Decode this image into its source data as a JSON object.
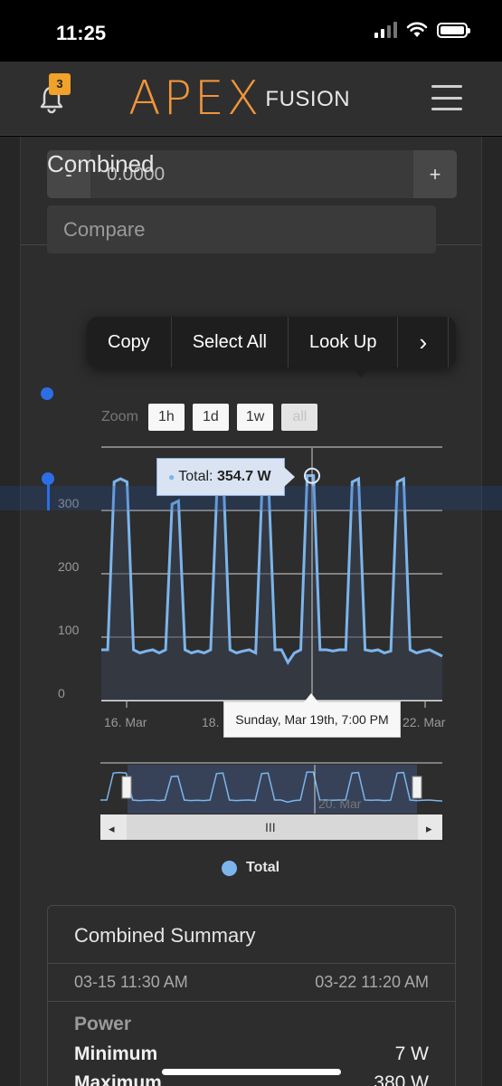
{
  "status_bar": {
    "time": "11:25"
  },
  "nav": {
    "notification_count": "3",
    "logo_main": "APEX",
    "logo_sub": "FUSION"
  },
  "stepper": {
    "minus": "-",
    "value": "0.0000",
    "plus": "+"
  },
  "section": {
    "title": "Combined",
    "compare_placeholder": "Compare"
  },
  "context_menu": {
    "items": [
      "Copy",
      "Select All",
      "Look Up"
    ],
    "more": "›"
  },
  "zoom": {
    "label": "Zoom",
    "buttons": [
      "1h",
      "1d",
      "1w",
      "all"
    ]
  },
  "tooltip": {
    "series": "Total:",
    "value": "354.7 W"
  },
  "x_tooltip": "Sunday, Mar 19th, 7:00 PM",
  "navigator": {
    "label": "20. Mar",
    "grip": "III",
    "left": "◂",
    "right": "▸"
  },
  "legend": {
    "label": "Total",
    "color": "#7cb5ec"
  },
  "chart_data": {
    "type": "area",
    "title": "Combined",
    "xlabel": "",
    "ylabel": "",
    "y_ticks": [
      0,
      100,
      200,
      300
    ],
    "x_ticks": [
      "16. Mar",
      "18.",
      "22. Mar"
    ],
    "ylim": [
      0,
      400
    ],
    "grid": true,
    "legend_position": "bottom",
    "series": [
      {
        "name": "Total",
        "color": "#7cb5ec",
        "values": [
          80,
          80,
          345,
          350,
          345,
          80,
          75,
          78,
          80,
          75,
          80,
          310,
          315,
          80,
          75,
          78,
          75,
          80,
          340,
          345,
          80,
          75,
          78,
          80,
          75,
          340,
          345,
          80,
          80,
          60,
          75,
          80,
          355,
          355,
          80,
          80,
          78,
          80,
          80,
          345,
          350,
          80,
          78,
          80,
          75,
          78,
          345,
          350,
          80,
          75,
          78,
          80,
          75,
          70
        ]
      }
    ],
    "highlight": {
      "label": "Sunday, Mar 19th, 7:00 PM",
      "value": 354.7,
      "unit": "W"
    }
  },
  "summary": {
    "title": "Combined Summary",
    "start": "03-15 11:30 AM",
    "end": "03-22 11:20 AM",
    "heading": "Power",
    "rows": [
      {
        "key": "Minimum",
        "value": "7 W"
      },
      {
        "key": "Maximum",
        "value": "380 W"
      }
    ]
  }
}
